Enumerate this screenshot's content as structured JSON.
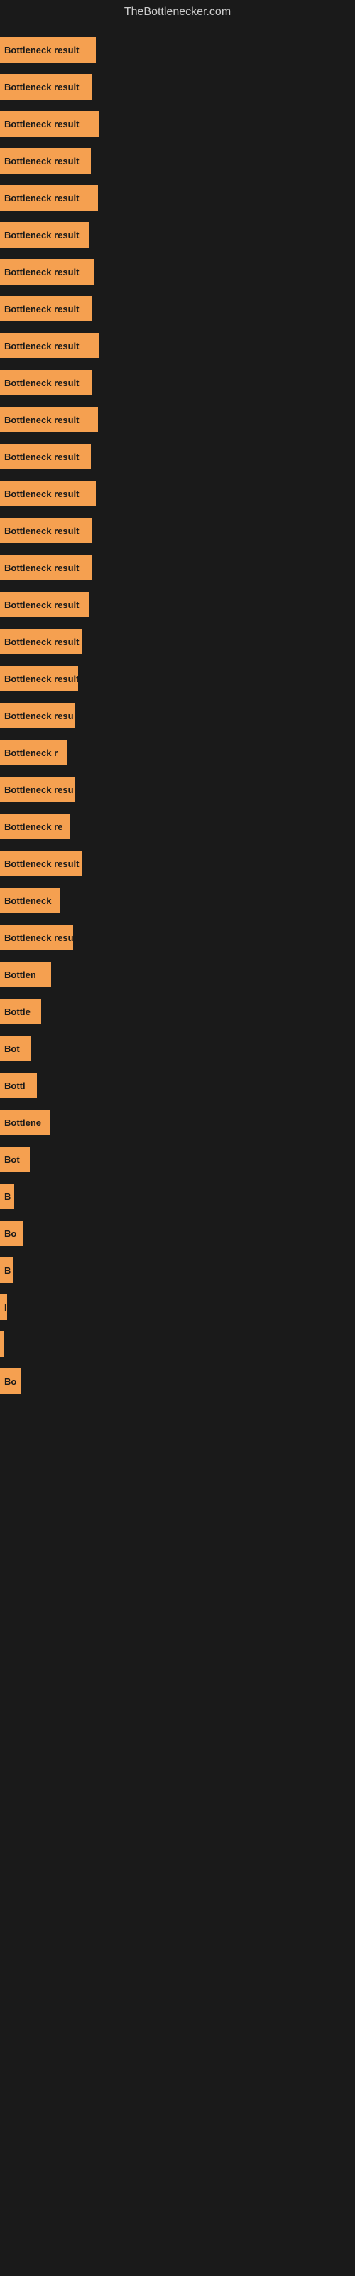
{
  "site": {
    "title": "TheBottlenecker.com"
  },
  "bars": [
    {
      "label": "Bottleneck result",
      "width": 135
    },
    {
      "label": "Bottleneck result",
      "width": 130
    },
    {
      "label": "Bottleneck result",
      "width": 140
    },
    {
      "label": "Bottleneck result",
      "width": 128
    },
    {
      "label": "Bottleneck result",
      "width": 138
    },
    {
      "label": "Bottleneck result",
      "width": 125
    },
    {
      "label": "Bottleneck result",
      "width": 133
    },
    {
      "label": "Bottleneck result",
      "width": 130
    },
    {
      "label": "Bottleneck result",
      "width": 140
    },
    {
      "label": "Bottleneck result",
      "width": 130
    },
    {
      "label": "Bottleneck result",
      "width": 138
    },
    {
      "label": "Bottleneck result",
      "width": 128
    },
    {
      "label": "Bottleneck result",
      "width": 135
    },
    {
      "label": "Bottleneck result",
      "width": 130
    },
    {
      "label": "Bottleneck result",
      "width": 130
    },
    {
      "label": "Bottleneck result",
      "width": 125
    },
    {
      "label": "Bottleneck result",
      "width": 115
    },
    {
      "label": "Bottleneck result",
      "width": 110
    },
    {
      "label": "Bottleneck resu",
      "width": 105
    },
    {
      "label": "Bottleneck r",
      "width": 95
    },
    {
      "label": "Bottleneck resu",
      "width": 105
    },
    {
      "label": "Bottleneck re",
      "width": 98
    },
    {
      "label": "Bottleneck result",
      "width": 115
    },
    {
      "label": "Bottleneck",
      "width": 85
    },
    {
      "label": "Bottleneck resu",
      "width": 103
    },
    {
      "label": "Bottlen",
      "width": 72
    },
    {
      "label": "Bottle",
      "width": 58
    },
    {
      "label": "Bot",
      "width": 44
    },
    {
      "label": "Bottl",
      "width": 52
    },
    {
      "label": "Bottlene",
      "width": 70
    },
    {
      "label": "Bot",
      "width": 42
    },
    {
      "label": "B",
      "width": 20
    },
    {
      "label": "Bo",
      "width": 32
    },
    {
      "label": "B",
      "width": 18
    },
    {
      "label": "I",
      "width": 10
    },
    {
      "label": "",
      "width": 5
    },
    {
      "label": "Bo",
      "width": 30
    }
  ]
}
